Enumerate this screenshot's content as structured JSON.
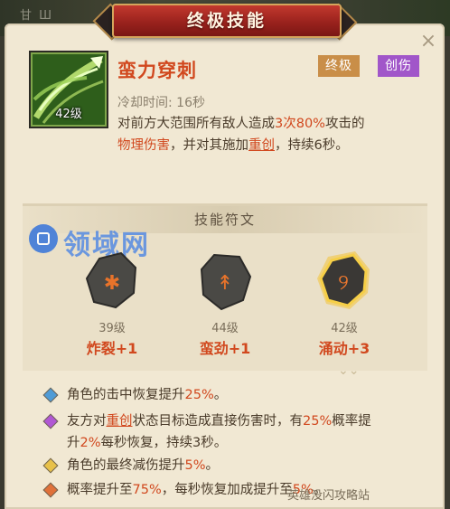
{
  "bg_label": "甘 Ш",
  "banner": {
    "title": "终极技能"
  },
  "close": {
    "symbol": "×"
  },
  "skill": {
    "level": "42级",
    "name": "蛮力穿刺",
    "tags": {
      "ultimate": "终极",
      "bleed": "创伤"
    },
    "cooldown": "冷却时间: 16秒",
    "desc": {
      "p1": "对前方大范围所有敌人造成",
      "hits": "3次",
      "pct": "80%",
      "p2": "攻击的",
      "dmg": "物理伤害",
      "p3": "，并对其施加",
      "status": "重创",
      "p4": "，持续6秒。"
    }
  },
  "runes": {
    "header": "技能符文",
    "items": [
      {
        "level": "39级",
        "name": "炸裂+1",
        "glyph": "✱",
        "state": "inactive"
      },
      {
        "level": "44级",
        "name": "蛮劲+1",
        "glyph": "↟",
        "state": "inactive"
      },
      {
        "level": "42级",
        "name": "涌动+3",
        "glyph": "୨",
        "state": "active"
      }
    ],
    "scroll_hint": "⌄⌄"
  },
  "watermark": {
    "text": "领域网"
  },
  "bonuses": [
    {
      "color": "#4f9bd6",
      "a": "角色的击中恢复提升",
      "b": "25%",
      "c": "。"
    },
    {
      "color": "#b157d4",
      "a": "友方对",
      "b": "重创",
      "c": "状态目标造成直接伤害时，有",
      "d": "25%",
      "e": "概率提",
      "f": "升",
      "g": "2%",
      "h": "每秒恢复，持续3秒。"
    },
    {
      "color": "#e8c14a",
      "a": "角色的最终减伤提升",
      "b": "5%",
      "c": "。"
    },
    {
      "color": "#e0713a",
      "a": "概率提升至",
      "b": "75%",
      "c": "，每秒恢复加成提升至",
      "d": "5%",
      "e": "。"
    }
  ],
  "footer": "英雄没闪攻略站"
}
